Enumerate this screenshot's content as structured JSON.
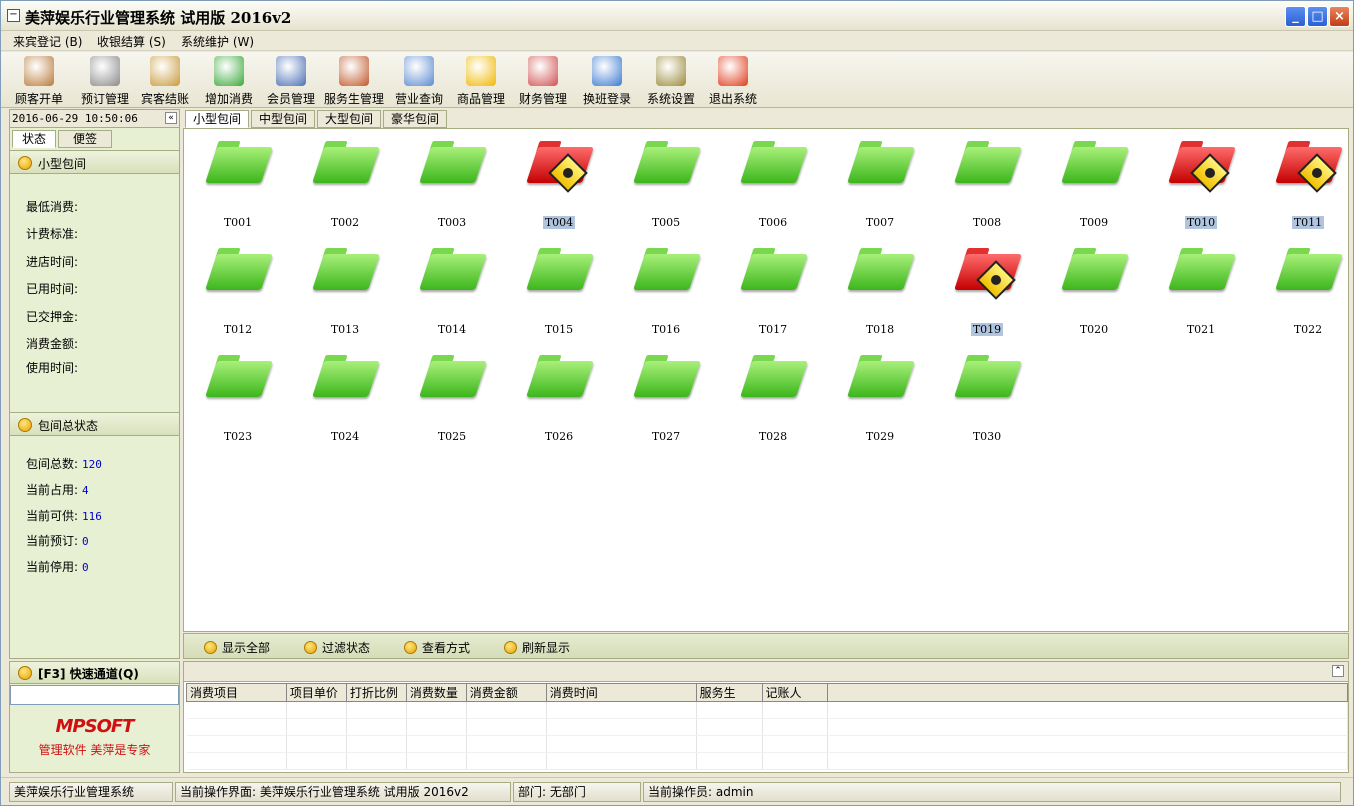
{
  "window": {
    "title": "美萍娱乐行业管理系统 试用版  2016v2",
    "minimize": "_",
    "maximize": "□",
    "close": "×"
  },
  "menu": [
    "来宾登记 (B)",
    "收银结算 (S)",
    "系统维护 (W)"
  ],
  "toolbar": [
    {
      "label": "顾客开单",
      "icon": "open-order-icon",
      "color": "#b97a3a"
    },
    {
      "label": "预订管理",
      "icon": "clock-icon",
      "color": "#8a8a8a"
    },
    {
      "label": "宾客结账",
      "icon": "money-bag-icon",
      "color": "#c79a3a"
    },
    {
      "label": "增加消费",
      "icon": "add-consume-icon",
      "color": "#3aa83a"
    },
    {
      "label": "会员管理",
      "icon": "member-icon",
      "color": "#4a6fb5"
    },
    {
      "label": "服务生管理",
      "icon": "waiter-icon",
      "color": "#c0582a"
    },
    {
      "label": "营业查询",
      "icon": "magnifier-icon",
      "color": "#5a8ad0"
    },
    {
      "label": "商品管理",
      "icon": "star-icon",
      "color": "#f0b800"
    },
    {
      "label": "财务管理",
      "icon": "finance-icon",
      "color": "#d05050"
    },
    {
      "label": "换班登录",
      "icon": "shift-icon",
      "color": "#3a7ad0"
    },
    {
      "label": "系统设置",
      "icon": "settings-icon",
      "color": "#9a8a3a"
    },
    {
      "label": "退出系统",
      "icon": "exit-icon",
      "color": "#e03a1a"
    }
  ],
  "left": {
    "datetime": "2016-06-29 10:50:06",
    "collapse": "«",
    "tabs": [
      "状态",
      "便签"
    ],
    "room_section": "小型包间",
    "room_fields": [
      "最低消费:",
      "计费标准:",
      "进店时间:",
      "已用时间:",
      "已交押金:",
      "消费金额:",
      "使用时间:"
    ],
    "summary_section": "包间总状态",
    "summary": [
      {
        "k": "包间总数:",
        "v": "120"
      },
      {
        "k": "当前占用:",
        "v": "4"
      },
      {
        "k": "当前可供:",
        "v": "116"
      },
      {
        "k": "当前预订:",
        "v": "0"
      },
      {
        "k": "当前停用:",
        "v": "0"
      }
    ]
  },
  "quick": {
    "title": "[F3] 快速通道(Q)",
    "input_value": "",
    "brand": "MPSOFT",
    "slogan": "管理软件 美萍是专家"
  },
  "room_tabs": [
    "小型包间",
    "中型包间",
    "大型包间",
    "豪华包间"
  ],
  "rooms": [
    {
      "name": "T001",
      "busy": false
    },
    {
      "name": "T002",
      "busy": false
    },
    {
      "name": "T003",
      "busy": false
    },
    {
      "name": "T004",
      "busy": true
    },
    {
      "name": "T005",
      "busy": false
    },
    {
      "name": "T006",
      "busy": false
    },
    {
      "name": "T007",
      "busy": false
    },
    {
      "name": "T008",
      "busy": false
    },
    {
      "name": "T009",
      "busy": false
    },
    {
      "name": "T010",
      "busy": true
    },
    {
      "name": "T011",
      "busy": true
    },
    {
      "name": "T012",
      "busy": false
    },
    {
      "name": "T013",
      "busy": false
    },
    {
      "name": "T014",
      "busy": false
    },
    {
      "name": "T015",
      "busy": false
    },
    {
      "name": "T016",
      "busy": false
    },
    {
      "name": "T017",
      "busy": false
    },
    {
      "name": "T018",
      "busy": false
    },
    {
      "name": "T019",
      "busy": true
    },
    {
      "name": "T020",
      "busy": false
    },
    {
      "name": "T021",
      "busy": false
    },
    {
      "name": "T022",
      "busy": false
    },
    {
      "name": "T023",
      "busy": false
    },
    {
      "name": "T024",
      "busy": false
    },
    {
      "name": "T025",
      "busy": false
    },
    {
      "name": "T026",
      "busy": false
    },
    {
      "name": "T027",
      "busy": false
    },
    {
      "name": "T028",
      "busy": false
    },
    {
      "name": "T029",
      "busy": false
    },
    {
      "name": "T030",
      "busy": false
    }
  ],
  "bottom_buttons": [
    "显示全部",
    "过滤状态",
    "查看方式",
    "刷新显示"
  ],
  "detail": {
    "up": "⌃",
    "columns": [
      "消费项目",
      "项目单价",
      "打折比例",
      "消费数量",
      "消费金额",
      "消费时间",
      "服务生",
      "记账人"
    ]
  },
  "statusbar": [
    "美萍娱乐行业管理系统",
    "当前操作界面: 美萍娱乐行业管理系统 试用版  2016v2",
    "部门: 无部门",
    "当前操作员: admin"
  ],
  "colors": {
    "free_room": "#3cb61c",
    "busy_room": "#c40000",
    "panel_bg": "#E8F0D4"
  }
}
